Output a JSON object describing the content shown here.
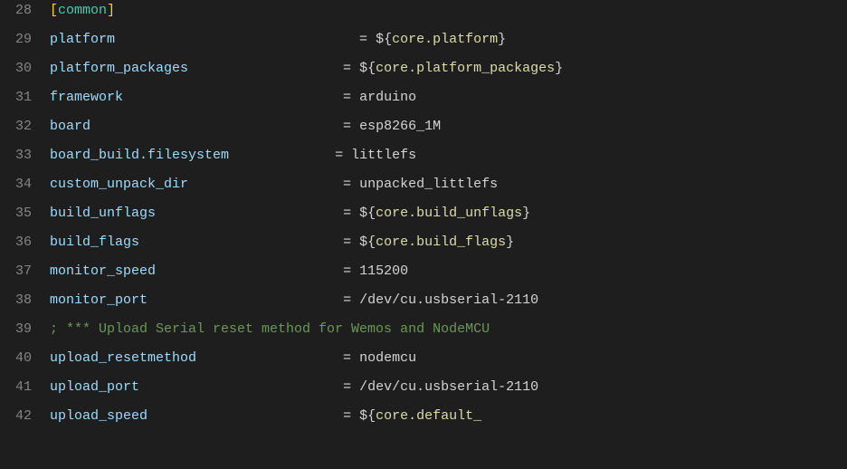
{
  "editor": {
    "background": "#1e1e1e",
    "lines": [
      {
        "number": "28",
        "tokens": [
          {
            "text": "[",
            "class": "section-bracket"
          },
          {
            "text": "common",
            "class": "key-cyan"
          },
          {
            "text": "]",
            "class": "section-bracket"
          }
        ]
      },
      {
        "number": "29",
        "tokens": [
          {
            "text": "platform",
            "class": "key-blue"
          },
          {
            "text": "                              = ",
            "class": "equals"
          },
          {
            "text": "${",
            "class": "value-white"
          },
          {
            "text": "core.platform",
            "class": "value-yellow"
          },
          {
            "text": "}",
            "class": "value-white"
          }
        ]
      },
      {
        "number": "30",
        "tokens": [
          {
            "text": "platform_packages",
            "class": "key-blue"
          },
          {
            "text": "                   = ",
            "class": "equals"
          },
          {
            "text": "${",
            "class": "value-white"
          },
          {
            "text": "core.platform_packages",
            "class": "value-yellow"
          },
          {
            "text": "}",
            "class": "value-white"
          }
        ]
      },
      {
        "number": "31",
        "tokens": [
          {
            "text": "framework",
            "class": "key-blue"
          },
          {
            "text": "                           = ",
            "class": "equals"
          },
          {
            "text": "arduino",
            "class": "value-white"
          }
        ]
      },
      {
        "number": "32",
        "tokens": [
          {
            "text": "board",
            "class": "key-blue"
          },
          {
            "text": "                               = ",
            "class": "equals"
          },
          {
            "text": "esp8266_1M",
            "class": "value-white"
          }
        ]
      },
      {
        "number": "33",
        "tokens": [
          {
            "text": "board_build.filesystem",
            "class": "key-blue"
          },
          {
            "text": "             = ",
            "class": "equals"
          },
          {
            "text": "littlefs",
            "class": "value-white"
          }
        ]
      },
      {
        "number": "34",
        "tokens": [
          {
            "text": "custom_unpack_dir",
            "class": "key-blue"
          },
          {
            "text": "                   = ",
            "class": "equals"
          },
          {
            "text": "unpacked_littlefs",
            "class": "value-white"
          }
        ]
      },
      {
        "number": "35",
        "tokens": [
          {
            "text": "build_unflags",
            "class": "key-blue"
          },
          {
            "text": "                       = ",
            "class": "equals"
          },
          {
            "text": "${",
            "class": "value-white"
          },
          {
            "text": "core.build_unflags",
            "class": "value-yellow"
          },
          {
            "text": "}",
            "class": "value-white"
          }
        ]
      },
      {
        "number": "36",
        "tokens": [
          {
            "text": "build_flags",
            "class": "key-blue"
          },
          {
            "text": "                         = ",
            "class": "equals"
          },
          {
            "text": "${",
            "class": "value-white"
          },
          {
            "text": "core.build_flags",
            "class": "value-yellow"
          },
          {
            "text": "}",
            "class": "value-white"
          }
        ]
      },
      {
        "number": "37",
        "tokens": [
          {
            "text": "monitor_speed",
            "class": "key-blue"
          },
          {
            "text": "                       = ",
            "class": "equals"
          },
          {
            "text": "115200",
            "class": "value-white"
          }
        ]
      },
      {
        "number": "38",
        "tokens": [
          {
            "text": "monitor_port",
            "class": "key-blue"
          },
          {
            "text": "                        = ",
            "class": "equals"
          },
          {
            "text": "/dev/cu.usbserial-2110",
            "class": "value-white"
          }
        ]
      },
      {
        "number": "39",
        "tokens": [
          {
            "text": "; *** Upload Serial reset method for Wemos and NodeMCU",
            "class": "comment-green"
          }
        ]
      },
      {
        "number": "40",
        "tokens": [
          {
            "text": "upload_resetmethod",
            "class": "key-blue"
          },
          {
            "text": "                  = ",
            "class": "equals"
          },
          {
            "text": "nodemcu",
            "class": "value-white"
          }
        ]
      },
      {
        "number": "41",
        "tokens": [
          {
            "text": "upload_port",
            "class": "key-blue"
          },
          {
            "text": "                         = ",
            "class": "equals"
          },
          {
            "text": "/dev/cu.usbserial-2110",
            "class": "value-white"
          }
        ]
      },
      {
        "number": "42",
        "tokens": [
          {
            "text": "upload_speed",
            "class": "key-blue"
          },
          {
            "text": "                        = ",
            "class": "equals"
          },
          {
            "text": "${",
            "class": "value-white"
          },
          {
            "text": "core.default_",
            "class": "value-yellow"
          }
        ]
      }
    ]
  }
}
